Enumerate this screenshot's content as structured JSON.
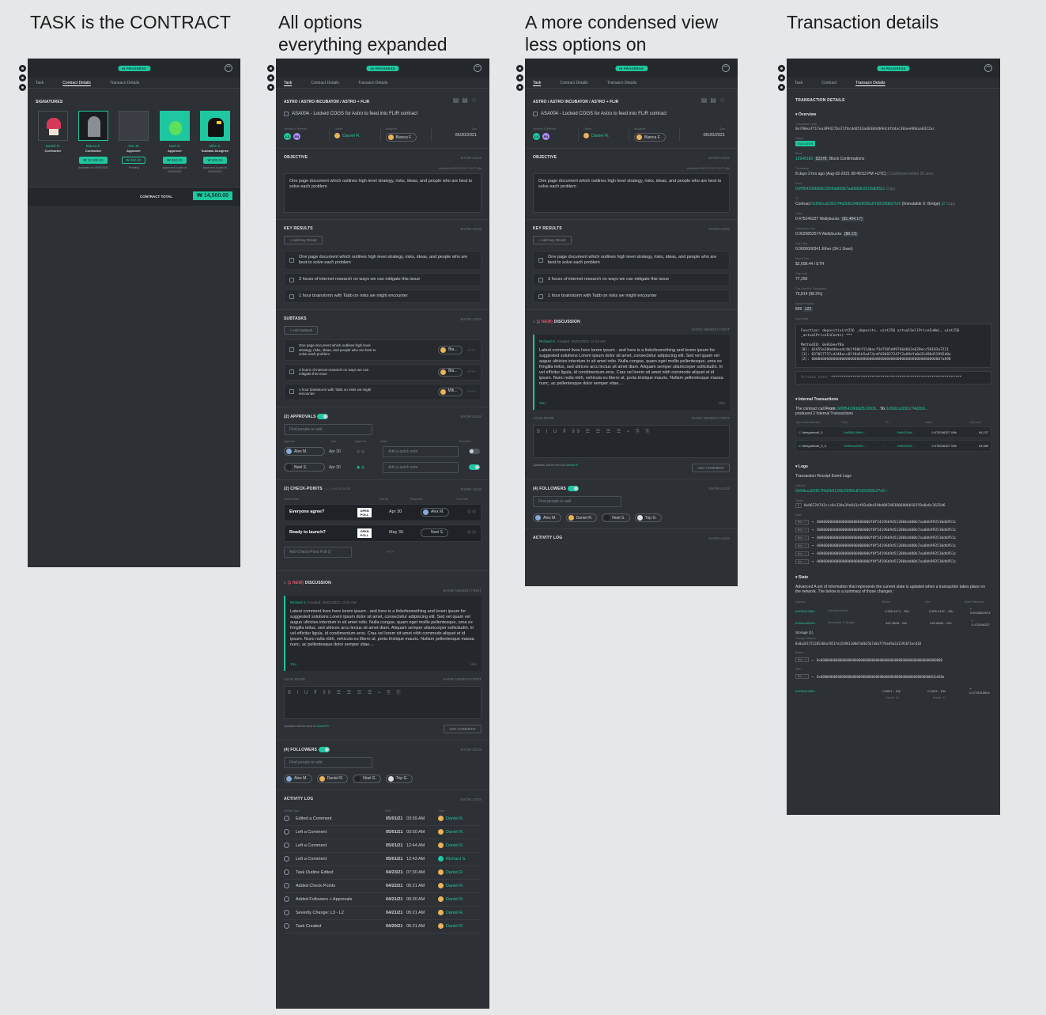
{
  "headings": {
    "h1": "TASK is the CONTRACT",
    "h2a": "All options",
    "h2b": "everything expanded",
    "h3a": "A more condensed view",
    "h3b": "less options on",
    "h4": "Transaction details"
  },
  "status": "IN PROGRESS",
  "tabs_a": [
    "Task",
    "Contract Details",
    "Transacn Details"
  ],
  "tabs_d": [
    "Task",
    "Contract",
    "Transacn Details"
  ],
  "contract": {
    "section_title": "SIGNATURES",
    "total_label": "CONTRACT TOTAL",
    "total_value": "₩ 14,500.00",
    "signers": [
      {
        "name": "Daniel R.",
        "role": "Contractee",
        "amount": "",
        "note": ""
      },
      {
        "name": "Bianca F.",
        "role": "Contractor",
        "amount": "₩ 12,000.00",
        "note": "Accepted on 04/02/2021"
      },
      {
        "name": "Alex M.",
        "role": "Approver",
        "amount": "₩ 850.00",
        "note": "Pending"
      },
      {
        "name": "Noel S.",
        "role": "Approver",
        "amount": "₩ 850.00",
        "note": "Approved & paid on 04/20/2021"
      },
      {
        "name": "Mike S.",
        "role": "Subtask Assignee",
        "amount": "₩ 800.00",
        "note": "Approved & paid on 04/20/2021"
      }
    ]
  },
  "task": {
    "breadcrumb": "ASTRO  /  ASTRO INCUBATOR  /  ASTRO + FLIR",
    "title": "ASA004 - Locked COGS for Astro to feed into FLIR contract",
    "meta": {
      "severity_label": "Severity & Refresh",
      "sev1": "L3",
      "sev2": "R4",
      "owner_label": "Owner",
      "owner": "Daniel R.",
      "assignee_label": "Assignee",
      "assignee": "Bianca F.",
      "due_label": "Due",
      "due": "05/20/2021"
    },
    "objective": {
      "title": "OBJECTIVE",
      "show": "SHOW LESS",
      "updated": "Updated",
      "updated_date": "05/27/2021  10:07 AM",
      "text": "One page document which outlines high level strategy, risks, ideas, and people who are best to solve each problem"
    },
    "key_results": {
      "title": "KEY RESULTS",
      "show": "SHOW LESS",
      "add": "+ Add Key Result",
      "items": [
        "One page document which outlines high level strategy, risks, ideas, and people who are best to solve each problem",
        "3 hours of internet research on ways we can mitigate this issue",
        "1 hour brainstorm with Tabb on risks we might encounter"
      ]
    },
    "subtasks": {
      "title": "SUBTASKS",
      "show": "SHOW LESS",
      "add": "+ Add Subtask",
      "items": [
        {
          "text": "One page document which outlines high level strategy, risks, ideas, and people who are best to solve each problem",
          "who": "Bla...",
          "date": "--/--/--"
        },
        {
          "text": "3 hours of internet research on ways we can mitigate this issue",
          "who": "Bla...",
          "date": "--/--/--"
        },
        {
          "text": "1 hour brainstorm with Tabb on risks we might encounter",
          "who": "Mik...",
          "date": "--/--/--"
        }
      ]
    },
    "approvals": {
      "title": "(2) APPROVALS",
      "show": "SHOW LESS",
      "search": "Find people to add",
      "cols": [
        "Approver",
        "Due",
        "Approval",
        "Notes",
        "Req Sent"
      ],
      "rows": [
        {
          "name": "Alex M.",
          "due": "Apr 30",
          "note": "Add a quick note"
        },
        {
          "name": "Noel S.",
          "due": "Apr 30",
          "note": "Add a quick note"
        }
      ]
    },
    "checkpoints": {
      "title": "(2) CHECK-POINTS",
      "d1": "04/30",
      "d2": "04/30",
      "show": "SHOW LESS",
      "cols": [
        "Check-Point",
        "Vote By",
        "Requester",
        "Your Vote"
      ],
      "rows": [
        {
          "q": "Everyone agree?",
          "poll": "OPEN POLL",
          "date": "Apr 30",
          "who": "Alex M."
        },
        {
          "q": "Ready to launch?",
          "poll": "OPEN POLL",
          "date": "May 30",
          "who": "Noel S."
        }
      ],
      "add": "Add Check-Point Poll Q",
      "add_date": "--/--"
    },
    "discussion": {
      "new": "(1 NEW)",
      "title": "DISCUSSION",
      "newest": "SHOW NEWEST FIRST",
      "author": "Richard S.",
      "created": "Created: 05/01/2021  12:43 AM",
      "text": "Latest comment lives here lorem ipsum - and here is a linkofsomething and lorem ipsum for suggested solutions Lorem ipsum dolor sit amet, consectetur adipiscing elit. Sed vel quam vel augue ultricies interdum in sit amet odio. Nulla congue, quam eget mollis pellentesque, urna ex fringilla tellus, sed ultrices arcu lectus sit amet diam. Aliquam semper ullamcorper sollicitudin. In vel efficitur ligula, id condimentum eros. Cras vel lorem sit amet nibh commodo aliquet et id ipsum. Nunc nulla nibh, vehicula eu libero at, porta tristique mauris. Nullam pellentesque massa nunc, ac pellentesque dolor semper vitae....",
      "you": "You",
      "like": "Like",
      "load_more": "LOAD MORE",
      "newest2": "SHOW NEWEST FIRST",
      "toolbar": "B I U ₮ 99 ☰ ☰ ☰ ☰  ⌁ ⎘ ⎘",
      "notify": "Updates will be sent to",
      "notify_who": "Daniel R.",
      "add_comment": "ADD COMMENT"
    },
    "followers": {
      "title": "(4) FOLLOWERS",
      "show": "SHOW LESS",
      "search": "Find people to add",
      "people": [
        "Alex M.",
        "Daniel R.",
        "Noel S.",
        "Trip G."
      ]
    },
    "activity": {
      "title": "ACTIVITY  LOG",
      "show": "SHOW LESS",
      "cols": [
        "Activity Type",
        "Date",
        "User"
      ],
      "rows": [
        {
          "type": "Edited a Comment",
          "date": "05/01/21",
          "time": "03:59 AM",
          "user": "Daniel R."
        },
        {
          "type": "Left a Comment",
          "date": "05/01/21",
          "time": "03:50 AM",
          "user": "Daniel R."
        },
        {
          "type": "Left a Comment",
          "date": "05/01/21",
          "time": "12:44 AM",
          "user": "Daniel R."
        },
        {
          "type": "Left a Comment",
          "date": "05/01/21",
          "time": "12:43 AM",
          "user": "Richard S."
        },
        {
          "type": "Task Outline Edited",
          "date": "04/23/21",
          "time": "07:30 AM",
          "user": "Daniel R."
        },
        {
          "type": "Added Check-Points",
          "date": "04/22/21",
          "time": "05:21 AM",
          "user": "Daniel R."
        },
        {
          "type": "Added Followers + Approvals",
          "date": "04/21/21",
          "time": "09:30 AM",
          "user": "Daniel R."
        },
        {
          "type": "Severity Change: L3 - L2",
          "date": "04/21/21",
          "time": "05:21 AM",
          "user": "Daniel R."
        },
        {
          "type": "Task Created",
          "date": "04/20/21",
          "time": "05:21 AM",
          "user": "Daniel R."
        }
      ]
    }
  },
  "tx": {
    "title": "TRANSACTION DETAILS",
    "overview": "Overview",
    "hash_label": "Transaction Hash",
    "hash": "0x790ea7f17ea399427ba72f8cddd516ad0384db9dcbf4dac30aee9b6aa8322ac",
    "status_label": "Status",
    "status": "SUCCESS",
    "block_label": "Block",
    "block": "12948180",
    "block_conf": "52378",
    "block_text": "Block Confirmations",
    "ts_label": "Timestamp",
    "ts": "8 days 3 hrs ago (Aug-02-2021 08:49:53 PM +UTC)",
    "ts_conf": "| Confirmed within 26 secs",
    "from_label": "From",
    "from": "0xf0f54196b9d51200bdd00b7aa0db963510db951c",
    "copy": "Copy",
    "to_label": "To",
    "to_pre": "Contract",
    "to": "0x5fdcca53617f4d2b9134b29090c87d01058e27e9",
    "to_post": "(Immutable X: Bridge)",
    "value_label": "Value",
    "value": "0.475246327 Wallybucks",
    "value_usd": "($1,494.17)",
    "fee_label": "Transaction Fee",
    "fee": "0.0025852574 Wallybucks",
    "fee_usd": "($8.13)",
    "gasprice_label": "Gas Price",
    "gasprice": "0.0000000341 Ether (34.1 Gwei)",
    "ether_label": "Ether Price",
    "ether": "$2,608.44 / ETH",
    "gaslimit_label": "Gas Limit",
    "gaslimit": "77,200",
    "gasused_label": "Gas Used by Transaction",
    "gasused": "75,814 (98.2%)",
    "nonce_label": "Nonce Position",
    "nonce": "899",
    "nonce_pos": "122",
    "input_label": "Input Data",
    "input_fn": "Function: deposit(uint256 _deposits, uint256 actualSellPriceInWei, uint256 _actualPriceInCents) ***",
    "input_m": "MethodID: 0x03aeef0a",
    "input_0": "[0]: 01655e20bd4bea4c4b1f60bf11dbacf3d7505d99766d662e639ecc58183a7221",
    "input_1": "[1]: 037057757cd248acc81f0d1b5a474cdf036827247f2a09dfa0d31490d51992d0e",
    "input_2": "[2]: 0000000000000000000000000000000000000000000000000000000000007a898",
    "private_label": "Private note:",
    "private": "*************************************************************",
    "internal_title": "Internal Transactions",
    "internal_text_a": "The contract call",
    "internal_from": "From",
    "internal_from_addr": "0xf0f54196b9d51200b...",
    "internal_to": "To",
    "internal_to_addr": "0x5fdcca53617f4d2b9...",
    "internal_text_b": "produced 2 Internal Transactions",
    "internal_cols": [
      "Type Trace Address",
      "From",
      "To",
      "Value",
      "Gas Limit"
    ],
    "internal_rows": [
      {
        "type": "delegatecall_0",
        "from": "0xf0f54196b9...",
        "to": "0xf0431b6...",
        "value": "0.475246327 Wlb",
        "gas": "49,137"
      },
      {
        "type": "delegatecall_0_0",
        "from": "0x5fdcca53b1...",
        "to": "0xf0431b6...",
        "value": "0.475246327 Wlb",
        "gas": "43,086"
      }
    ],
    "logs_title": "Logs",
    "logs_sub": "Transaction Receipt Event Logs",
    "logs_addr_label": "Address",
    "logs_addr": "0x5fdcca53617f4d2b9134b29090c87d01058e27e9",
    "logs_topics_label": "Topics",
    "logs_topic0": "0x06724742ccc8c330a39e641ef02a0b419bd092483606806b58159e0a8c2635d6",
    "logs_data_label": "Data",
    "logs_data": [
      "0000000000000000000000000f0f54196b9d51200bdd00b7aa0db993510db951c",
      "0000000000000000000000000f0f54196b9d51200bdd00b7aa0db993510db951c",
      "0000000000000000000000000f0f54196b9d51200bdd00b7aa0db993510db951c",
      "0000000000000000000000000f0f54196b9d51200bdd00b7aa0db993510db951c",
      "0000000000000000000000000f0f54196b9d51200bdd00b7aa0db993510db951c",
      "0000000000000000000000000f0f54196b9d51200bdd00b7aa0db993510db951c"
    ],
    "state_title": "State",
    "state_text": "Advanced A set of information that represents the current state is updated when a transaction takes place on the network. The below is a summary of those changes :",
    "state_cols": [
      "Address",
      "Before",
      "After",
      "State Difference"
    ],
    "state_rows": [
      {
        "addr": "0xf0f54196b9...",
        "tag": "(MiningPoolHub)",
        "before": "2,505.4171... Eth",
        "after": "2,505.4197... Eth",
        "diff": "+ 0.0025852574"
      },
      {
        "addr": "0x5fdcca53b1...",
        "tag": "(Immutable X: Bridge)",
        "before": "452.3608... Eth",
        "after": "452.8360... Eth",
        "diff": "+ 0.475246327"
      }
    ],
    "storage_label": "Storage (1)",
    "storage_addr_label": "Storage Address:",
    "storage_addr": "0x0a2b1f51205366a7051fe224941100d7a0b35b7a8a77f6e49a2a11910f1ecd18",
    "before_label": "Before",
    "before_val": "0x0000000000000000000000000000000000000000000000000000000000000000",
    "after_label": "After",
    "after_val": "0x000000000000000000000000000000000000000000000000000000000001b468a",
    "last_addr": "0xf0f54196b9...",
    "last_before": "0.6621... Eth",
    "last_after": "0.2043... Eth",
    "last_diff": "+ 0.4778315844",
    "nonce_a": "Nonce: 40",
    "nonce_b": "Nonce: 41"
  }
}
